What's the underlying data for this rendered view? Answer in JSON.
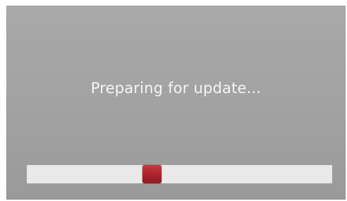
{
  "screen": {
    "status_text": "Preparing for update..."
  },
  "progress": {
    "fraction": 0.41,
    "thumb_color": "#b0282f",
    "track_color": "#e9e9e9"
  }
}
